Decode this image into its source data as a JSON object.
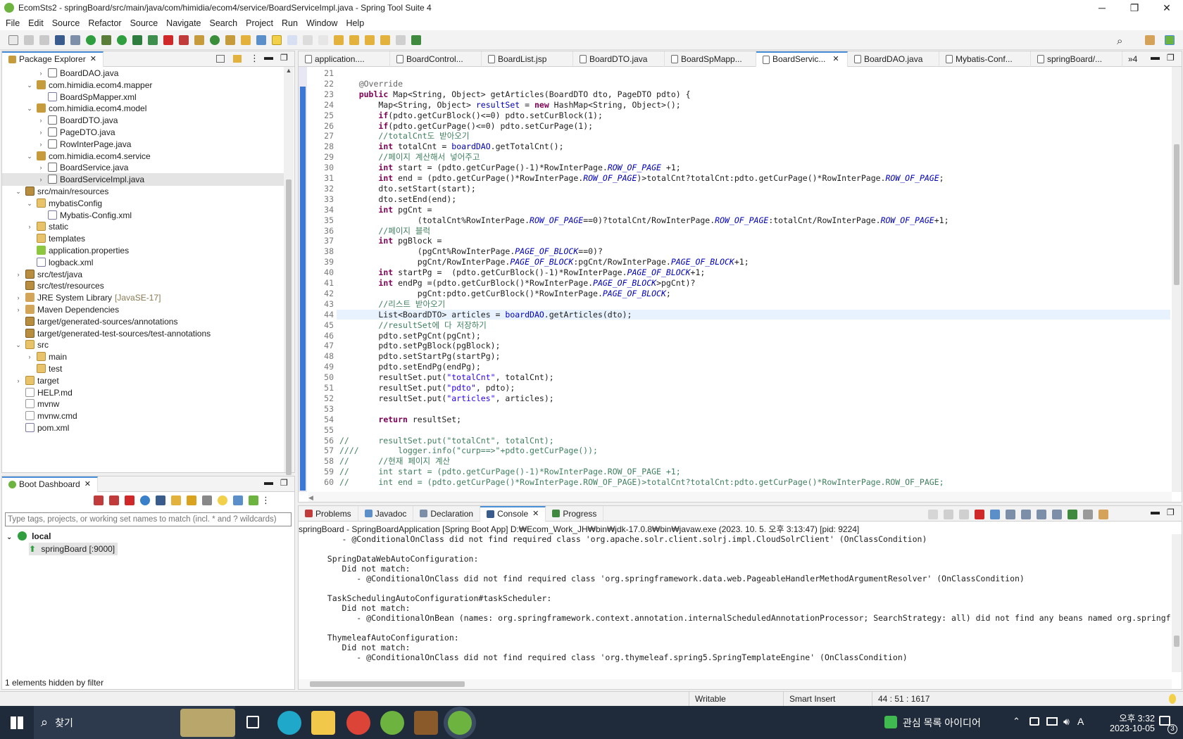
{
  "window": {
    "title": "EcomSts2 - springBoard/src/main/java/com/himidia/ecom4/service/BoardServiceImpl.java - Spring Tool Suite 4",
    "minimize": "─",
    "maximize": "❐",
    "close": "✕"
  },
  "menu": [
    "File",
    "Edit",
    "Source",
    "Refactor",
    "Source",
    "Navigate",
    "Search",
    "Project",
    "Run",
    "Window",
    "Help"
  ],
  "package_explorer": {
    "tab_label": "Package Explorer",
    "items": [
      {
        "label": "BoardDAO.java",
        "depth": 3,
        "icon": "java-file-icon",
        "twisty": "›"
      },
      {
        "label": "com.himidia.ecom4.mapper",
        "depth": 2,
        "icon": "package-icon",
        "twisty": "⌄"
      },
      {
        "label": "BoardSpMapper.xml",
        "depth": 3,
        "icon": "xml-file-icon",
        "twisty": ""
      },
      {
        "label": "com.himidia.ecom4.model",
        "depth": 2,
        "icon": "package-icon",
        "twisty": "⌄"
      },
      {
        "label": "BoardDTO.java",
        "depth": 3,
        "icon": "java-file-icon",
        "twisty": "›"
      },
      {
        "label": "PageDTO.java",
        "depth": 3,
        "icon": "java-file-icon",
        "twisty": "›"
      },
      {
        "label": "RowInterPage.java",
        "depth": 3,
        "icon": "java-file-icon",
        "twisty": "›"
      },
      {
        "label": "com.himidia.ecom4.service",
        "depth": 2,
        "icon": "package-icon",
        "twisty": "⌄"
      },
      {
        "label": "BoardService.java",
        "depth": 3,
        "icon": "java-file-icon",
        "twisty": "›"
      },
      {
        "label": "BoardServiceImpl.java",
        "depth": 3,
        "icon": "java-file-icon",
        "twisty": "›",
        "selected": true
      },
      {
        "label": "src/main/resources",
        "depth": 1,
        "icon": "source-folder-icon",
        "twisty": "⌄"
      },
      {
        "label": "mybatisConfig",
        "depth": 2,
        "icon": "folder-icon",
        "twisty": "⌄"
      },
      {
        "label": "Mybatis-Config.xml",
        "depth": 3,
        "icon": "xml-file-icon",
        "twisty": ""
      },
      {
        "label": "static",
        "depth": 2,
        "icon": "folder-icon",
        "twisty": "›"
      },
      {
        "label": "templates",
        "depth": 2,
        "icon": "folder-icon",
        "twisty": ""
      },
      {
        "label": "application.properties",
        "depth": 2,
        "icon": "properties-file-icon",
        "twisty": ""
      },
      {
        "label": "logback.xml",
        "depth": 2,
        "icon": "xml-file-icon",
        "twisty": ""
      },
      {
        "label": "src/test/java",
        "depth": 1,
        "icon": "source-folder-icon",
        "twisty": "›"
      },
      {
        "label": "src/test/resources",
        "depth": 1,
        "icon": "source-folder-icon",
        "twisty": ""
      },
      {
        "label": "JRE System Library",
        "suffix": "[JavaSE-17]",
        "depth": 1,
        "icon": "library-icon",
        "twisty": "›"
      },
      {
        "label": "Maven Dependencies",
        "depth": 1,
        "icon": "library-icon",
        "twisty": "›"
      },
      {
        "label": "target/generated-sources/annotations",
        "depth": 1,
        "icon": "source-folder-icon",
        "twisty": ""
      },
      {
        "label": "target/generated-test-sources/test-annotations",
        "depth": 1,
        "icon": "source-folder-icon",
        "twisty": ""
      },
      {
        "label": "src",
        "depth": 1,
        "icon": "folder-icon",
        "twisty": "⌄"
      },
      {
        "label": "main",
        "depth": 2,
        "icon": "folder-icon",
        "twisty": "›"
      },
      {
        "label": "test",
        "depth": 2,
        "icon": "folder-icon",
        "twisty": ""
      },
      {
        "label": "target",
        "depth": 1,
        "icon": "folder-icon",
        "twisty": "›"
      },
      {
        "label": "HELP.md",
        "depth": 1,
        "icon": "file-icon",
        "twisty": ""
      },
      {
        "label": "mvnw",
        "depth": 1,
        "icon": "file-icon",
        "twisty": ""
      },
      {
        "label": "mvnw.cmd",
        "depth": 1,
        "icon": "file-icon",
        "twisty": ""
      },
      {
        "label": "pom.xml",
        "depth": 1,
        "icon": "xml-file-icon",
        "twisty": ""
      }
    ]
  },
  "boot_dashboard": {
    "tab_label": "Boot Dashboard",
    "filter_placeholder": "Type tags, projects, or working set names to match (incl. * and ? wildcards)",
    "group": "local",
    "app": "springBoard [:9000]",
    "footer": "1 elements hidden by filter"
  },
  "editor_tabs": [
    {
      "label": "application....",
      "active": false
    },
    {
      "label": "BoardControl...",
      "active": false
    },
    {
      "label": "BoardList.jsp",
      "active": false
    },
    {
      "label": "BoardDTO.java",
      "active": false
    },
    {
      "label": "BoardSpMapp...",
      "active": false
    },
    {
      "label": "BoardServic...",
      "active": true
    },
    {
      "label": "BoardDAO.java",
      "active": false
    },
    {
      "label": "Mybatis-Conf...",
      "active": false
    },
    {
      "label": "springBoard/...",
      "active": false
    }
  ],
  "editor_overflow": "»4",
  "code_lines": [
    {
      "n": "21",
      "parts": [
        [
          "",
          ""
        ]
      ]
    },
    {
      "n": "22",
      "parts": [
        [
          "an",
          "    @Override"
        ]
      ]
    },
    {
      "n": "23",
      "parts": [
        [
          "",
          "    "
        ],
        [
          "kw",
          "public"
        ],
        [
          "",
          " Map<String, Object> getArticles(BoardDTO dto, PageDTO pdto) {"
        ]
      ]
    },
    {
      "n": "24",
      "parts": [
        [
          "",
          "        Map<String, Object> "
        ],
        [
          "fd",
          "resultSet"
        ],
        [
          "",
          " = "
        ],
        [
          "kw",
          "new"
        ],
        [
          "",
          " HashMap<String, Object>();"
        ]
      ]
    },
    {
      "n": "25",
      "parts": [
        [
          "",
          "        "
        ],
        [
          "kw",
          "if"
        ],
        [
          "",
          "(pdto.getCurBlock()<=0) pdto.setCurBlock(1);"
        ]
      ]
    },
    {
      "n": "26",
      "parts": [
        [
          "",
          "        "
        ],
        [
          "kw",
          "if"
        ],
        [
          "",
          "(pdto.getCurPage()<=0) pdto.setCurPage(1);"
        ]
      ]
    },
    {
      "n": "27",
      "parts": [
        [
          "cm",
          "        //totalCnt도 받아오기"
        ]
      ]
    },
    {
      "n": "28",
      "parts": [
        [
          "",
          "        "
        ],
        [
          "kw",
          "int"
        ],
        [
          "",
          " totalCnt = "
        ],
        [
          "fd",
          "boardDAO"
        ],
        [
          "",
          ".getTotalCnt();"
        ]
      ]
    },
    {
      "n": "29",
      "parts": [
        [
          "cm",
          "        //페이지 계산해서 넣어주고"
        ]
      ]
    },
    {
      "n": "30",
      "parts": [
        [
          "",
          "        "
        ],
        [
          "kw",
          "int"
        ],
        [
          "",
          " start = (pdto.getCurPage()-1)*RowInterPage."
        ],
        [
          "sf",
          "ROW_OF_PAGE"
        ],
        [
          "",
          " +1;"
        ]
      ]
    },
    {
      "n": "31",
      "parts": [
        [
          "",
          "        "
        ],
        [
          "kw",
          "int"
        ],
        [
          "",
          " end = (pdto.getCurPage()*RowInterPage."
        ],
        [
          "sf",
          "ROW_OF_PAGE"
        ],
        [
          "",
          ")>totalCnt?totalCnt:pdto.getCurPage()*RowInterPage."
        ],
        [
          "sf",
          "ROW_OF_PAGE"
        ],
        [
          "",
          ";"
        ]
      ]
    },
    {
      "n": "32",
      "parts": [
        [
          "",
          "        dto.setStart(start);"
        ]
      ]
    },
    {
      "n": "33",
      "parts": [
        [
          "",
          "        dto.setEnd(end);"
        ]
      ]
    },
    {
      "n": "34",
      "parts": [
        [
          "",
          "        "
        ],
        [
          "kw",
          "int"
        ],
        [
          "",
          " pgCnt ="
        ]
      ]
    },
    {
      "n": "35",
      "parts": [
        [
          "",
          "                (totalCnt%RowInterPage."
        ],
        [
          "sf",
          "ROW_OF_PAGE"
        ],
        [
          "",
          "==0)?totalCnt/RowInterPage."
        ],
        [
          "sf",
          "ROW_OF_PAGE"
        ],
        [
          "",
          ":totalCnt/RowInterPage."
        ],
        [
          "sf",
          "ROW_OF_PAGE"
        ],
        [
          "",
          "+1;"
        ]
      ]
    },
    {
      "n": "36",
      "parts": [
        [
          "cm",
          "        //페이지 블럭"
        ]
      ]
    },
    {
      "n": "37",
      "parts": [
        [
          "",
          "        "
        ],
        [
          "kw",
          "int"
        ],
        [
          "",
          " pgBlock ="
        ]
      ]
    },
    {
      "n": "38",
      "parts": [
        [
          "",
          "                (pgCnt%RowInterPage."
        ],
        [
          "sf",
          "PAGE_OF_BLOCK"
        ],
        [
          "",
          "==0)?"
        ]
      ]
    },
    {
      "n": "39",
      "parts": [
        [
          "",
          "                pgCnt/RowInterPage."
        ],
        [
          "sf",
          "PAGE_OF_BLOCK"
        ],
        [
          "",
          ":pgCnt/RowInterPage."
        ],
        [
          "sf",
          "PAGE_OF_BLOCK"
        ],
        [
          "",
          "+1;"
        ]
      ]
    },
    {
      "n": "40",
      "parts": [
        [
          "",
          "        "
        ],
        [
          "kw",
          "int"
        ],
        [
          "",
          " startPg =  (pdto.getCurBlock()-1)*RowInterPage."
        ],
        [
          "sf",
          "PAGE_OF_BLOCK"
        ],
        [
          "",
          "+1;"
        ]
      ]
    },
    {
      "n": "41",
      "parts": [
        [
          "",
          "        "
        ],
        [
          "kw",
          "int"
        ],
        [
          "",
          " endPg =(pdto.getCurBlock()*RowInterPage."
        ],
        [
          "sf",
          "PAGE_OF_BLOCK"
        ],
        [
          "",
          ">pgCnt)?"
        ]
      ]
    },
    {
      "n": "42",
      "parts": [
        [
          "",
          "                pgCnt:pdto.getCurBlock()*RowInterPage."
        ],
        [
          "sf",
          "PAGE_OF_BLOCK"
        ],
        [
          "",
          ";"
        ]
      ]
    },
    {
      "n": "43",
      "parts": [
        [
          "cm",
          "        //리스트 받아오기"
        ]
      ]
    },
    {
      "n": "44",
      "parts": [
        [
          "",
          "        List<BoardDTO> articles = "
        ],
        [
          "fd",
          "boardDAO"
        ],
        [
          "",
          ".getArticles(dto);"
        ]
      ],
      "current": true
    },
    {
      "n": "45",
      "parts": [
        [
          "cm",
          "        //resultSet에 다 저장하기"
        ]
      ]
    },
    {
      "n": "46",
      "parts": [
        [
          "",
          "        pdto.setPgCnt(pgCnt);"
        ]
      ]
    },
    {
      "n": "47",
      "parts": [
        [
          "",
          "        pdto.setPgBlock(pgBlock);"
        ]
      ]
    },
    {
      "n": "48",
      "parts": [
        [
          "",
          "        pdto.setStartPg(startPg);"
        ]
      ]
    },
    {
      "n": "49",
      "parts": [
        [
          "",
          "        pdto.setEndPg(endPg);"
        ]
      ]
    },
    {
      "n": "50",
      "parts": [
        [
          "",
          "        resultSet.put("
        ],
        [
          "st",
          "\"totalCnt\""
        ],
        [
          "",
          ", totalCnt);"
        ]
      ]
    },
    {
      "n": "51",
      "parts": [
        [
          "",
          "        resultSet.put("
        ],
        [
          "st",
          "\"pdto\""
        ],
        [
          "",
          ", pdto);"
        ]
      ]
    },
    {
      "n": "52",
      "parts": [
        [
          "",
          "        resultSet.put("
        ],
        [
          "st",
          "\"articles\""
        ],
        [
          "",
          ", articles);"
        ]
      ]
    },
    {
      "n": "53",
      "parts": [
        [
          "",
          ""
        ]
      ]
    },
    {
      "n": "54",
      "parts": [
        [
          "",
          "        "
        ],
        [
          "kw",
          "return"
        ],
        [
          "",
          " resultSet;"
        ]
      ]
    },
    {
      "n": "55",
      "parts": [
        [
          "",
          ""
        ]
      ]
    },
    {
      "n": "56",
      "parts": [
        [
          "cm",
          "//      resultSet.put(\"totalCnt\", totalCnt);"
        ]
      ]
    },
    {
      "n": "57",
      "parts": [
        [
          "cm",
          "////        logger.info(\"curp==>\"+pdto.getCurPage());"
        ]
      ]
    },
    {
      "n": "58",
      "parts": [
        [
          "cm",
          "//      //현재 페이지 계산"
        ]
      ]
    },
    {
      "n": "59",
      "parts": [
        [
          "cm",
          "//      int start = (pdto.getCurPage()-1)*RowInterPage.ROW_OF_PAGE +1;"
        ]
      ]
    },
    {
      "n": "60",
      "parts": [
        [
          "cm",
          "//      int end = (pdto.getCurPage()*RowInterPage.ROW_OF_PAGE)>totalCnt?totalCnt:pdto.getCurPage()*RowInterPage.ROW_OF_PAGE;"
        ]
      ]
    }
  ],
  "bottom_tabs": [
    {
      "label": "Problems",
      "active": false
    },
    {
      "label": "Javadoc",
      "active": false
    },
    {
      "label": "Declaration",
      "active": false
    },
    {
      "label": "Console",
      "active": true
    },
    {
      "label": "Progress",
      "active": false
    }
  ],
  "console": {
    "header": "springBoard - SpringBoardApplication [Spring Boot App] D:₩Ecom_Work_JH₩bin₩jdk-17.0.8₩bin₩javaw.exe  (2023. 10. 5. 오후 3:13:47) [pid: 9224]",
    "lines": [
      "      - @ConditionalOnClass did not find required class 'org.apache.solr.client.solrj.impl.CloudSolrClient' (OnClassCondition)",
      "",
      "   SpringDataWebAutoConfiguration:",
      "      Did not match:",
      "         - @ConditionalOnClass did not find required class 'org.springframework.data.web.PageableHandlerMethodArgumentResolver' (OnClassCondition)",
      "",
      "   TaskSchedulingAutoConfiguration#taskScheduler:",
      "      Did not match:",
      "         - @ConditionalOnBean (names: org.springframework.context.annotation.internalScheduledAnnotationProcessor; SearchStrategy: all) did not find any beans named org.springfr",
      "",
      "   ThymeleafAutoConfiguration:",
      "      Did not match:",
      "         - @ConditionalOnClass did not find required class 'org.thymeleaf.spring5.SpringTemplateEngine' (OnClassCondition)"
    ]
  },
  "status": {
    "writable": "Writable",
    "insert_mode": "Smart Insert",
    "position": "44 : 51 : 1617"
  },
  "taskbar": {
    "search_label": "찾기",
    "tray_text": "관심 목록 아이디어",
    "time": "오후 3:32",
    "date": "2023-10-05",
    "notifications": "3",
    "ime": "A"
  },
  "colors": {
    "accent": "#4a8fd9",
    "current_line": "#e8f2fe",
    "taskbar": "#1f2a3a"
  }
}
